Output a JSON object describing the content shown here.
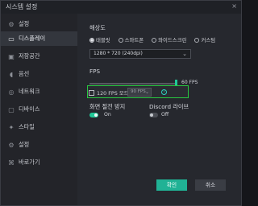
{
  "window": {
    "title": "시스템 설정",
    "close_icon": "×"
  },
  "sidebar": {
    "items": [
      {
        "label": "설정",
        "icon": "gear-icon",
        "active": false
      },
      {
        "label": "디스플레이",
        "icon": "display-icon",
        "active": true
      },
      {
        "label": "저장공간",
        "icon": "storage-icon",
        "active": false
      },
      {
        "label": "음선",
        "icon": "sound-icon",
        "active": false
      },
      {
        "label": "네트워크",
        "icon": "network-icon",
        "active": false
      },
      {
        "label": "디바이스",
        "icon": "device-icon",
        "active": false
      },
      {
        "label": "스타일",
        "icon": "style-icon",
        "active": false
      },
      {
        "label": "설정",
        "icon": "settings-icon",
        "active": false
      },
      {
        "label": "바로가기",
        "icon": "shortcut-icon",
        "active": false
      }
    ]
  },
  "display": {
    "resolution_label": "해상도",
    "resolution_options": [
      {
        "label": "태블릿",
        "selected": true
      },
      {
        "label": "스마트폰",
        "selected": false
      },
      {
        "label": "와이드스크린",
        "selected": false
      },
      {
        "label": "커스텀",
        "selected": false
      }
    ],
    "resolution_value": "1280 * 720 (240dpi)",
    "fps_label": "FPS",
    "fps_value": "60 FPS",
    "fps_level_fraction": 1.0,
    "hfps_label": "120 FPS 모드",
    "hfps_select_value": "90 FPS",
    "screen_sleep_label": "화면 절전 방지",
    "screen_sleep_state": "On",
    "discord_label": "Discord 라이브",
    "discord_state": "Off"
  },
  "buttons": {
    "ok": "확인",
    "cancel": "취소"
  },
  "colors": {
    "accent": "#20c997",
    "highlight_border": "#28c840"
  }
}
